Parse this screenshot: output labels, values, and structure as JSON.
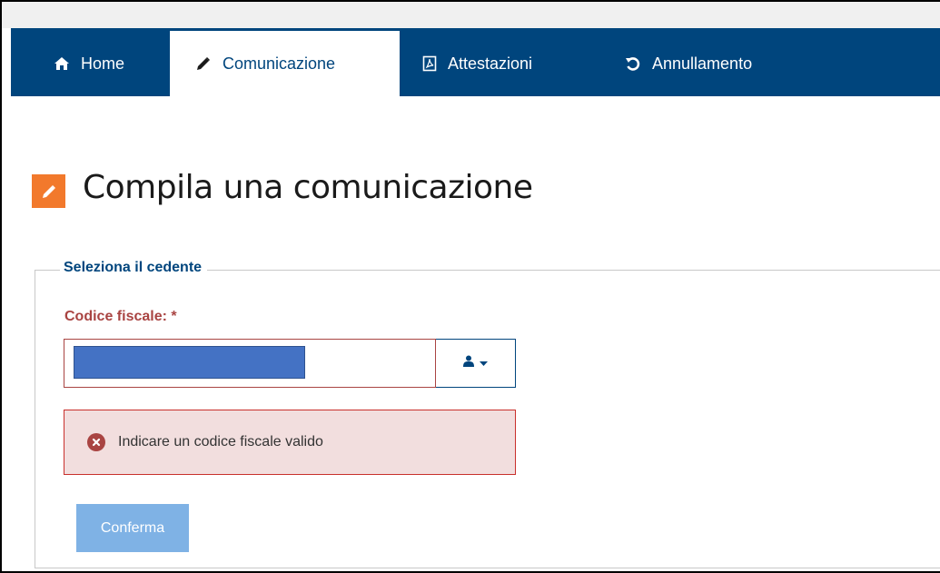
{
  "nav": {
    "tabs": [
      {
        "label": "Home",
        "icon": "home-icon"
      },
      {
        "label": "Comunicazione",
        "icon": "pencil-icon",
        "active": true
      },
      {
        "label": "Attestazioni",
        "icon": "pdf-file-icon"
      },
      {
        "label": "Annullamento",
        "icon": "undo-icon"
      }
    ]
  },
  "page": {
    "title": "Compila una comunicazione",
    "title_icon": "pencil-icon"
  },
  "form": {
    "legend": "Seleziona il cedente",
    "codice_fiscale": {
      "label": "Codice fiscale: *",
      "value": "",
      "button_icon": "user-icon"
    },
    "error": {
      "icon": "error-circle-icon",
      "message": "Indicare un codice fiscale valido"
    },
    "confirm_label": "Conferma"
  },
  "colors": {
    "nav_bg": "#00457d",
    "title_badge": "#f2792c",
    "error_border": "#c9302c",
    "error_bg": "#f2dede",
    "error_text": "#a94442",
    "confirm_bg": "#7fb2e5"
  }
}
